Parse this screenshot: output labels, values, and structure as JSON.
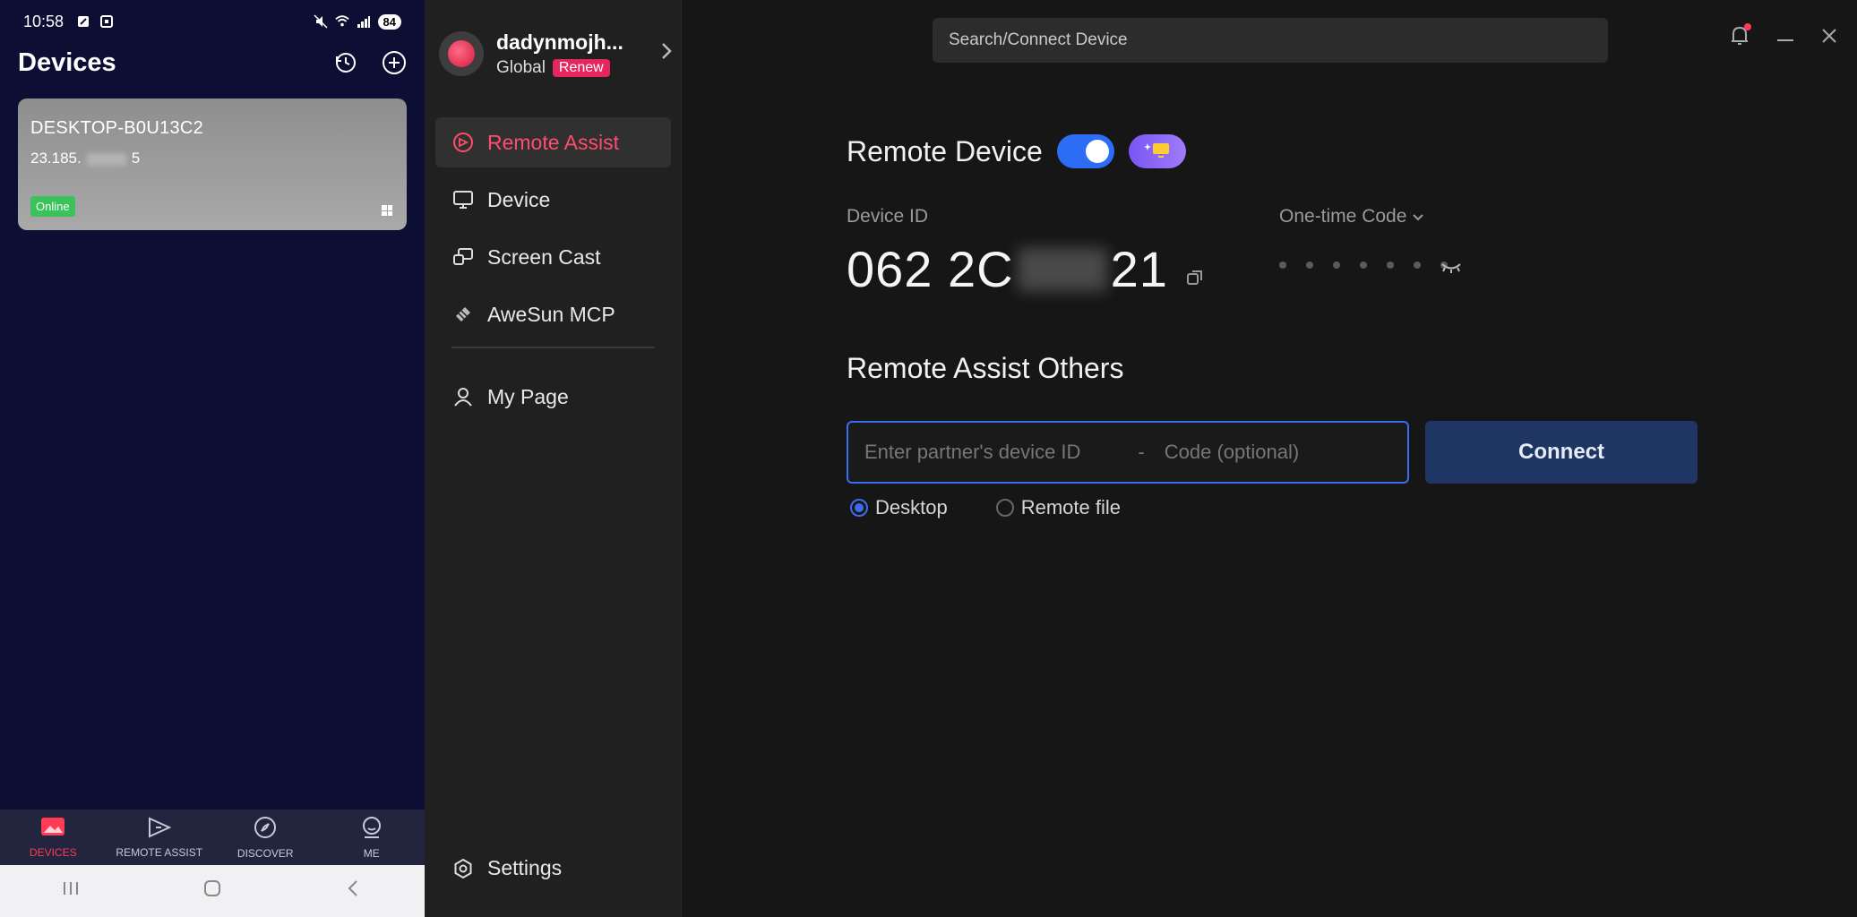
{
  "phone": {
    "status": {
      "time": "10:58",
      "battery": "84"
    },
    "title": "Devices",
    "device_card": {
      "name": "DESKTOP-B0U13C2",
      "ip_start": "23.185.",
      "ip_end": "5",
      "status": "Online"
    },
    "tabs": [
      {
        "label": "DEVICES",
        "icon": "image-icon",
        "active": true
      },
      {
        "label": "REMOTE ASSIST",
        "icon": "remote-assist-icon",
        "active": false
      },
      {
        "label": "DISCOVER",
        "icon": "compass-icon",
        "active": false
      },
      {
        "label": "ME",
        "icon": "user-icon",
        "active": false
      }
    ]
  },
  "app": {
    "profile": {
      "name": "dadynmojh...",
      "region": "Global",
      "badge": "Renew"
    },
    "search_placeholder": "Search/Connect Device",
    "nav": [
      {
        "label": "Remote Assist",
        "icon": "remote-assist-icon",
        "active": true
      },
      {
        "label": "Device",
        "icon": "monitor-icon",
        "active": false
      },
      {
        "label": "Screen Cast",
        "icon": "screen-cast-icon",
        "active": false
      },
      {
        "label": "AweSun MCP",
        "icon": "mcp-icon",
        "active": false
      },
      {
        "label": "My Page",
        "icon": "person-icon",
        "active": false
      }
    ],
    "settings_label": "Settings",
    "remote_device": {
      "title": "Remote Device",
      "toggle_on": true,
      "device_id_label": "Device ID",
      "device_id_start": "062 2C",
      "device_id_end": "21",
      "code_label": "One-time Code"
    },
    "assist": {
      "title": "Remote Assist Others",
      "id_placeholder": "Enter partner's device ID",
      "separator": "-",
      "code_placeholder": "Code (optional)",
      "connect_label": "Connect",
      "options": [
        {
          "label": "Desktop",
          "selected": true
        },
        {
          "label": "Remote file",
          "selected": false
        }
      ]
    },
    "colors": {
      "accent": "#ff4d6a",
      "primary": "#3b6df0"
    }
  }
}
